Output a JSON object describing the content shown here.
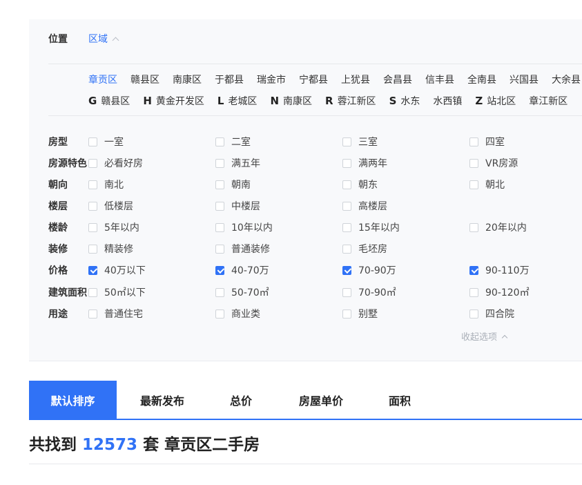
{
  "location": {
    "label": "位置",
    "tab": "区域",
    "districts": [
      "章贡区",
      "赣县区",
      "南康区",
      "于都县",
      "瑞金市",
      "宁都县",
      "上犹县",
      "会昌县",
      "信丰县",
      "全南县",
      "兴国县",
      "大余县"
    ],
    "active_district": "章贡区",
    "letter_groups": [
      {
        "letter": "G",
        "items": [
          "赣县区"
        ]
      },
      {
        "letter": "H",
        "items": [
          "黄金开发区"
        ]
      },
      {
        "letter": "L",
        "items": [
          "老城区"
        ]
      },
      {
        "letter": "N",
        "items": [
          "南康区"
        ]
      },
      {
        "letter": "R",
        "items": [
          "蓉江新区"
        ]
      },
      {
        "letter": "S",
        "items": [
          "水东",
          "水西镇"
        ]
      },
      {
        "letter": "Z",
        "items": [
          "站北区",
          "章江新区"
        ]
      }
    ]
  },
  "filters": [
    {
      "label": "房型",
      "options": [
        {
          "text": "一室",
          "checked": false
        },
        {
          "text": "二室",
          "checked": false
        },
        {
          "text": "三室",
          "checked": false
        },
        {
          "text": "四室",
          "checked": false
        }
      ]
    },
    {
      "label": "房源特色",
      "options": [
        {
          "text": "必看好房",
          "checked": false
        },
        {
          "text": "满五年",
          "checked": false
        },
        {
          "text": "满两年",
          "checked": false
        },
        {
          "text": "VR房源",
          "checked": false
        }
      ]
    },
    {
      "label": "朝向",
      "options": [
        {
          "text": "南北",
          "checked": false
        },
        {
          "text": "朝南",
          "checked": false
        },
        {
          "text": "朝东",
          "checked": false
        },
        {
          "text": "朝北",
          "checked": false
        }
      ]
    },
    {
      "label": "楼层",
      "options": [
        {
          "text": "低楼层",
          "checked": false
        },
        {
          "text": "中楼层",
          "checked": false
        },
        {
          "text": "高楼层",
          "checked": false
        }
      ]
    },
    {
      "label": "楼龄",
      "options": [
        {
          "text": "5年以内",
          "checked": false
        },
        {
          "text": "10年以内",
          "checked": false
        },
        {
          "text": "15年以内",
          "checked": false
        },
        {
          "text": "20年以内",
          "checked": false
        }
      ]
    },
    {
      "label": "装修",
      "options": [
        {
          "text": "精装修",
          "checked": false
        },
        {
          "text": "普通装修",
          "checked": false
        },
        {
          "text": "毛坯房",
          "checked": false
        }
      ]
    },
    {
      "label": "价格",
      "options": [
        {
          "text": "40万以下",
          "checked": true
        },
        {
          "text": "40-70万",
          "checked": true
        },
        {
          "text": "70-90万",
          "checked": true
        },
        {
          "text": "90-110万",
          "checked": true
        }
      ]
    },
    {
      "label": "建筑面积",
      "options": [
        {
          "text": "50㎡以下",
          "checked": false
        },
        {
          "text": "50-70㎡",
          "checked": false
        },
        {
          "text": "70-90㎡",
          "checked": false
        },
        {
          "text": "90-120㎡",
          "checked": false
        }
      ]
    },
    {
      "label": "用途",
      "options": [
        {
          "text": "普通住宅",
          "checked": false
        },
        {
          "text": "商业类",
          "checked": false
        },
        {
          "text": "别墅",
          "checked": false
        },
        {
          "text": "四合院",
          "checked": false
        }
      ]
    }
  ],
  "collapse_label": "收起选项",
  "sort": {
    "tabs": [
      "默认排序",
      "最新发布",
      "总价",
      "房屋单价",
      "面积"
    ],
    "active": "默认排序"
  },
  "result": {
    "prefix": "共找到",
    "count": "12573",
    "suffix": "套 章贡区二手房"
  },
  "colors": {
    "accent": "#3072f6",
    "panel_bg": "#f8f9fb"
  }
}
